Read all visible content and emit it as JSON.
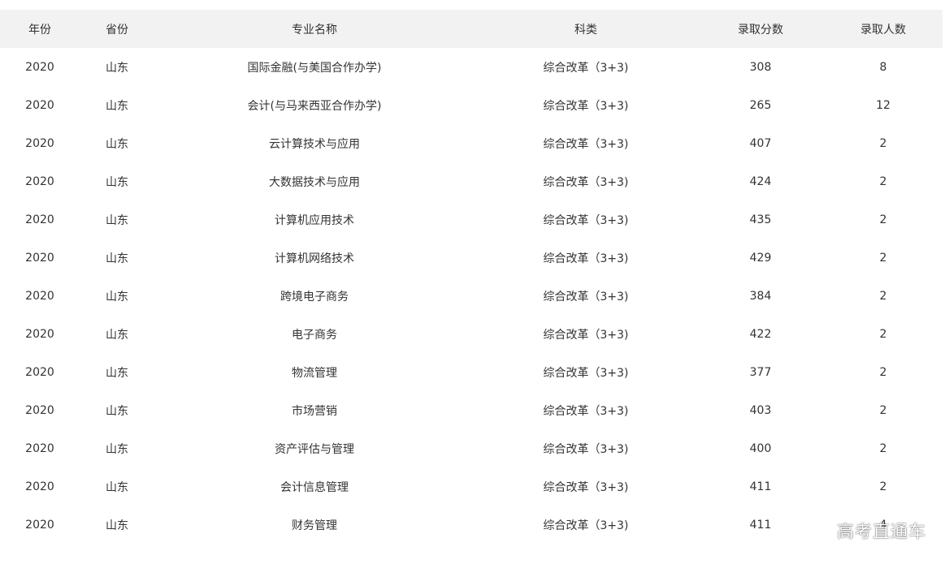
{
  "table": {
    "headers": [
      "年份",
      "省份",
      "专业名称",
      "科类",
      "录取分数",
      "录取人数"
    ],
    "rows": [
      [
        "2020",
        "山东",
        "国际金融(与美国合作办学)",
        "综合改革（3+3)",
        "308",
        "8"
      ],
      [
        "2020",
        "山东",
        "会计(与马来西亚合作办学)",
        "综合改革（3+3)",
        "265",
        "12"
      ],
      [
        "2020",
        "山东",
        "云计算技术与应用",
        "综合改革（3+3)",
        "407",
        "2"
      ],
      [
        "2020",
        "山东",
        "大数据技术与应用",
        "综合改革（3+3)",
        "424",
        "2"
      ],
      [
        "2020",
        "山东",
        "计算机应用技术",
        "综合改革（3+3)",
        "435",
        "2"
      ],
      [
        "2020",
        "山东",
        "计算机网络技术",
        "综合改革（3+3)",
        "429",
        "2"
      ],
      [
        "2020",
        "山东",
        "跨境电子商务",
        "综合改革（3+3)",
        "384",
        "2"
      ],
      [
        "2020",
        "山东",
        "电子商务",
        "综合改革（3+3)",
        "422",
        "2"
      ],
      [
        "2020",
        "山东",
        "物流管理",
        "综合改革（3+3)",
        "377",
        "2"
      ],
      [
        "2020",
        "山东",
        "市场营销",
        "综合改革（3+3)",
        "403",
        "2"
      ],
      [
        "2020",
        "山东",
        "资产评估与管理",
        "综合改革（3+3)",
        "400",
        "2"
      ],
      [
        "2020",
        "山东",
        "会计信息管理",
        "综合改革（3+3)",
        "411",
        "2"
      ],
      [
        "2020",
        "山东",
        "财务管理",
        "综合改革（3+3)",
        "411",
        "4"
      ]
    ]
  },
  "watermark": "高考直通车",
  "colors": {
    "header_bg": "#f2f2f2",
    "text": "#333333",
    "background": "#ffffff"
  }
}
